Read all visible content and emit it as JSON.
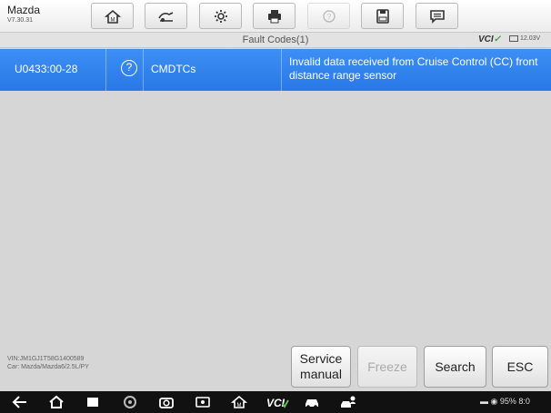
{
  "header": {
    "brand": "Mazda",
    "version": "V7.30.31",
    "toolbar": [
      {
        "icon": "home-icon"
      },
      {
        "icon": "vehicle-swap-icon"
      },
      {
        "icon": "gear-icon"
      },
      {
        "icon": "printer-icon"
      },
      {
        "icon": "help-icon",
        "disabled": true
      },
      {
        "icon": "save-icon"
      },
      {
        "icon": "chat-icon"
      }
    ]
  },
  "status_strip": {
    "title": "Fault Codes(1)",
    "vci_label": "VCI",
    "voltage": "12.03V"
  },
  "fault_codes": [
    {
      "code": "U0433:00-28",
      "status": "CMDTCs",
      "description": "Invalid data received from Cruise Control (CC) front distance range sensor"
    }
  ],
  "vehicle_info": {
    "vin": "VIN:JM1GJ1T58G1400589",
    "car": "Car: Mazda/Mazda6/2.5L/PY"
  },
  "buttons": {
    "service_manual_line1": "Service",
    "service_manual_line2": "manual",
    "freeze": "Freeze",
    "search": "Search",
    "esc": "ESC"
  },
  "system_status": {
    "battery": "95%",
    "time": "8:0"
  },
  "colors": {
    "selected_row": "#2f80ed",
    "vci_check": "#3aa03a"
  }
}
